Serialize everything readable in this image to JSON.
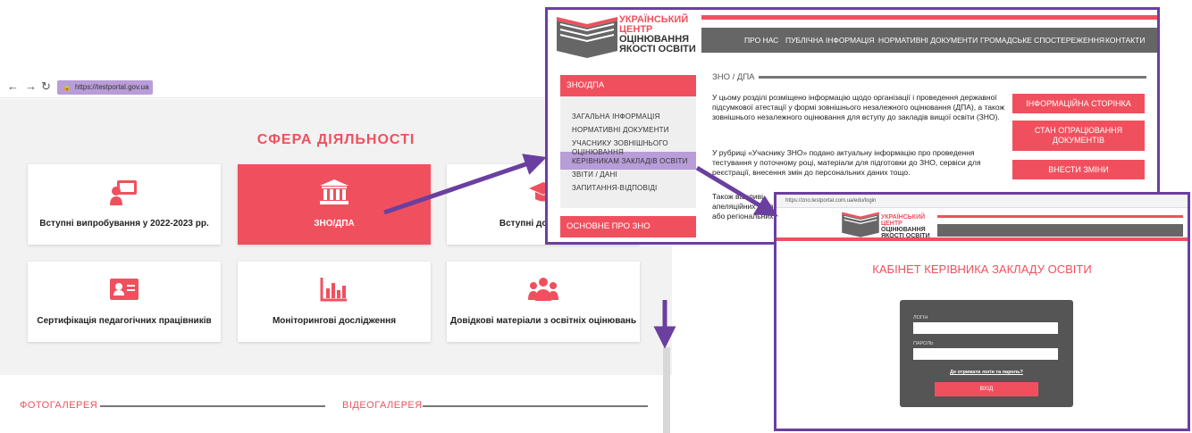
{
  "browser": {
    "url": "https://testportal.gov.ua",
    "section_title": "СФЕРА ДІЯЛЬНОСТІ",
    "cards": [
      {
        "label": "Вступні випробування у 2022-2023 рр.",
        "icon": "teacher-board-icon",
        "active": false
      },
      {
        "label": "ЗНО/ДПА",
        "icon": "institution-icon",
        "active": true
      },
      {
        "label": "Вступні до магістра",
        "icon": "graduation-cap-icon",
        "active": false
      },
      {
        "label": "Сертифікація педагогічних працівників",
        "icon": "id-card-icon",
        "active": false
      },
      {
        "label": "Моніторингові дослідження",
        "icon": "bar-chart-icon",
        "active": false
      },
      {
        "label": "Довідкові матеріали з освітніх оцінювань",
        "icon": "people-group-icon",
        "active": false
      }
    ],
    "photo_gallery": "ФОТОГАЛЕРЕЯ",
    "video_gallery": "ВІДЕОГАЛЕРЕЯ"
  },
  "uceqa": {
    "logo_lines": [
      "УКРАЇНСЬКИЙ",
      "ЦЕНТР",
      "ОЦІНЮВАННЯ",
      "ЯКОСТІ ОСВІТИ"
    ],
    "menu": [
      "ПРО НАС",
      "ПУБЛІЧНА ІНФОРМАЦІЯ",
      "НОРМАТИВНІ ДОКУМЕНТИ",
      "ГРОМАДСЬКЕ СПОСТЕРЕЖЕННЯ",
      "КОНТАКТИ"
    ],
    "sidebar_head": "ЗНО/ДПА",
    "sidebar_links": [
      "ЗАГАЛЬНА ІНФОРМАЦІЯ",
      "НОРМАТИВНІ ДОКУМЕНТИ",
      "УЧАСНИКУ ЗОВНІШНЬОГО",
      "ОЦІНЮВАННЯ",
      "КЕРІВНИКАМ ЗАКЛАДІВ ОСВІТИ",
      "ЗВІТИ / ДАНІ",
      "ЗАПИТАННЯ-ВІДПОВІДІ"
    ],
    "sidebar_foot": "ОСНОВНЕ ПРО ЗНО",
    "content_title": "ЗНО / ДПА",
    "paragraph1": "У цьому розділі розміщено інформацію щодо організації і проведення державної підсумкової атестації у формі зовнішнього незалежного оцінювання (ДПА), а також зовнішнього незалежного оцінювання для вступу до закладів вищої освіти (ЗНО).",
    "paragraph2": "У рубриці «Учаснику ЗНО» подано актуальну інформацію про проведення тестування у поточному році, матеріали для підготовки до ЗНО, сервіси для реєстрації, внесення змін до персональних даних тощо.",
    "paragraph3_a": "Також важливі",
    "paragraph3_b": "апеляційних заяв",
    "paragraph3_c": "або регіональних",
    "buttons": [
      "ІНФОРМАЦІЙНА СТОРІНКА",
      "СТАН ОПРАЦЮВАННЯ ДОКУМЕНТІВ",
      "ВНЕСТИ ЗМІНИ"
    ]
  },
  "login": {
    "url": "https://zno.testportal.com.ua/edu/login",
    "logo_lines": [
      "УКРАЇНСЬКИЙ",
      "ЦЕНТР",
      "ОЦІНЮВАННЯ",
      "ЯКОСТІ ОСВІТИ"
    ],
    "title": "КАБІНЕТ КЕРІВНИКА ЗАКЛАДУ ОСВІТИ",
    "login_label": "ЛОГІН",
    "password_label": "ПАРОЛЬ",
    "forgot": "Де отримати логін та пароль?",
    "submit": "ВХІД"
  },
  "colors": {
    "accent": "#f0505e",
    "highlight": "#b89dd8",
    "frame": "#6b3fa0",
    "arrow": "#6b3fa0"
  }
}
